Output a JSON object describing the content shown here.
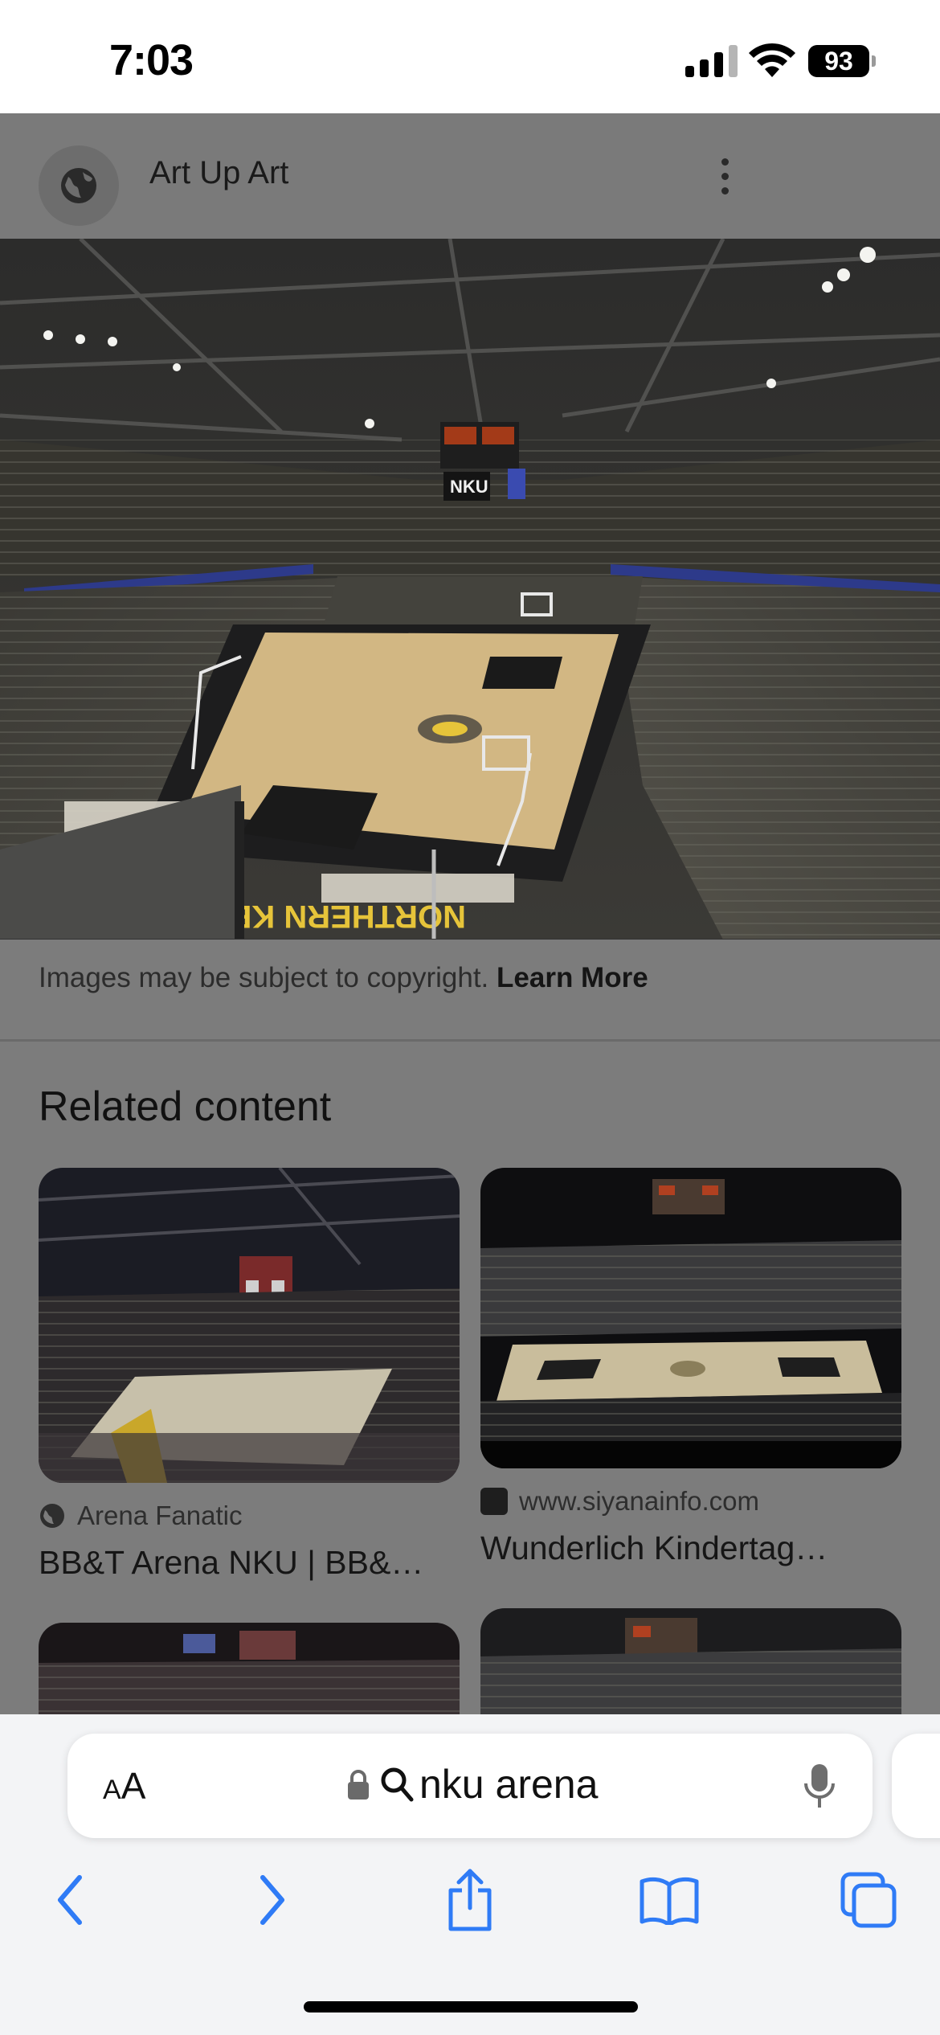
{
  "status_bar": {
    "time": "7:03",
    "battery": "93"
  },
  "site": {
    "name": "Art Up Art"
  },
  "hero": {
    "alt": "NKU"
  },
  "copyright": {
    "text": "Images may be subject to copyright.",
    "link": "Learn More"
  },
  "related": {
    "title": "Related content",
    "items": [
      {
        "source": "Arena Fanatic",
        "title": "BB&T Arena NKU | BB&…"
      },
      {
        "source": "www.siyanainfo.com",
        "title": "Wunderlich Kindertag…"
      }
    ]
  },
  "browser": {
    "aa_small": "A",
    "aa_big": "A",
    "url": "nku arena"
  },
  "colors": {
    "accent": "#2f7bf6",
    "dim_overlay": "#7c7c7c"
  }
}
